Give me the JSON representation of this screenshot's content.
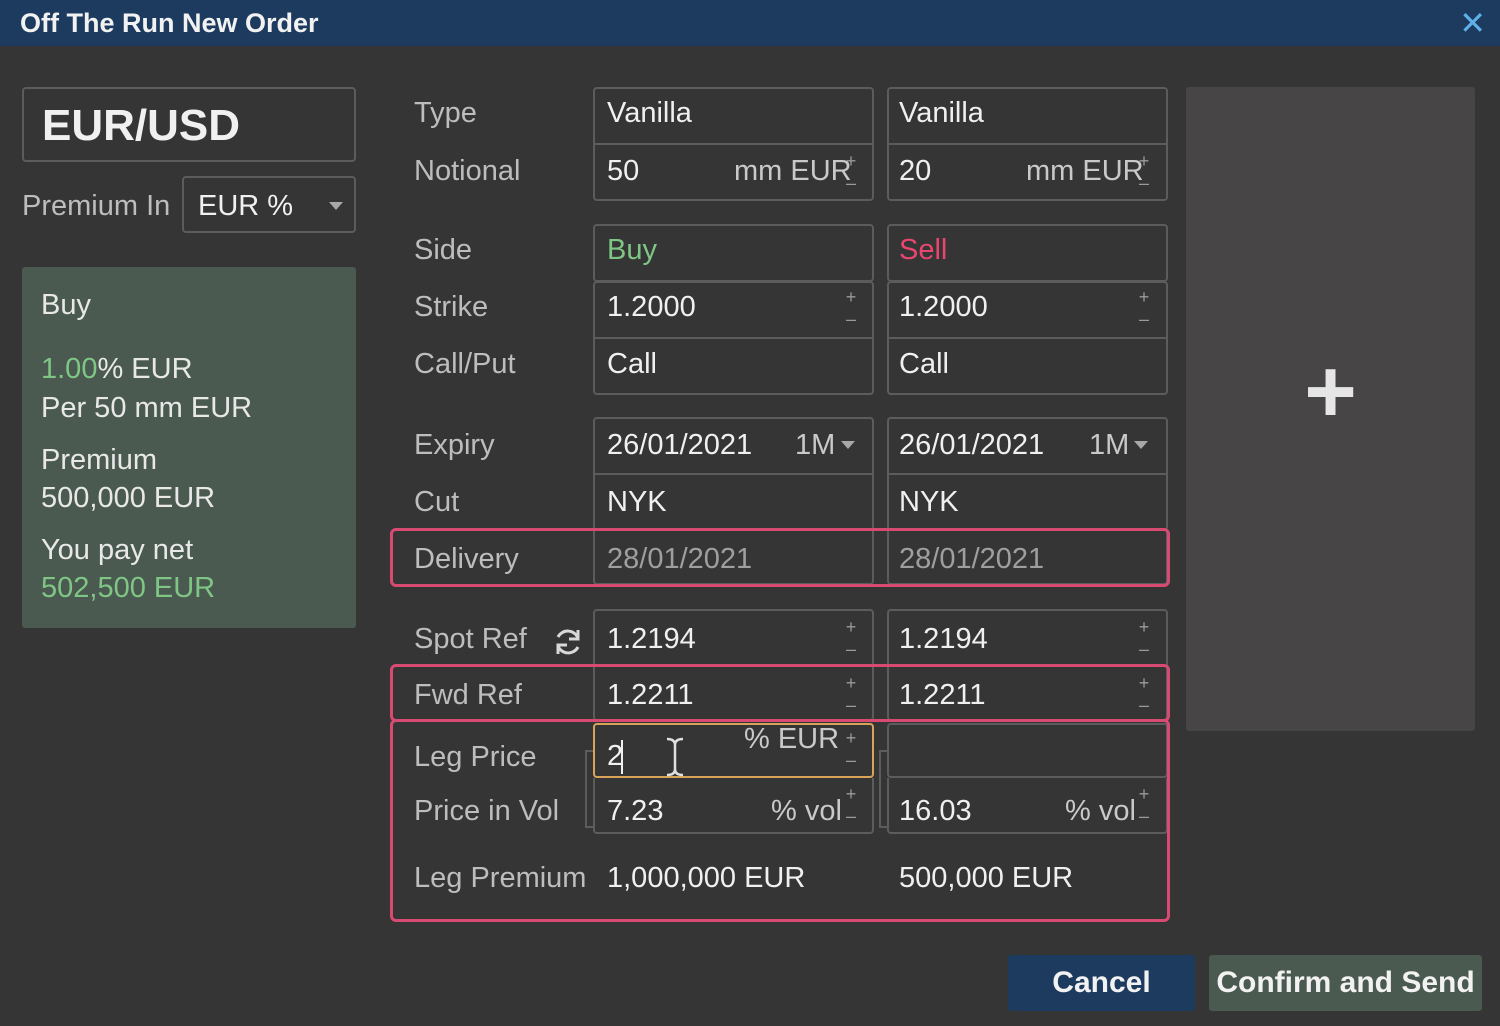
{
  "window": {
    "title": "Off The Run New Order",
    "close_glyph": "✕"
  },
  "pair": "EUR/USD",
  "premium_in": {
    "label": "Premium In",
    "value": "EUR %"
  },
  "summary": {
    "side": "Buy",
    "price_pct": "1.00",
    "price_unit": "% EUR",
    "per_line": "Per 50 mm EUR",
    "premium_label": "Premium",
    "premium_value": "500,000 EUR",
    "net_label": "You pay net",
    "net_value": "502,500 EUR"
  },
  "labels": {
    "type": "Type",
    "notional": "Notional",
    "side": "Side",
    "strike": "Strike",
    "callput": "Call/Put",
    "expiry": "Expiry",
    "cut": "Cut",
    "delivery": "Delivery",
    "spot_ref": "Spot Ref",
    "fwd_ref": "Fwd Ref",
    "leg_price": "Leg Price",
    "price_in_vol": "Price in Vol",
    "leg_premium": "Leg Premium"
  },
  "legs": [
    {
      "type": "Vanilla",
      "notional": "50",
      "notional_unit": "mm EUR",
      "side": "Buy",
      "strike": "1.2000",
      "callput": "Call",
      "expiry": "26/01/2021",
      "tenor": "1M",
      "cut": "NYK",
      "delivery": "28/01/2021",
      "spot_ref": "1.2194",
      "fwd_ref": "1.2211",
      "leg_price": "2",
      "leg_price_unit": "% EUR",
      "price_in_vol": "7.23",
      "vol_unit": "% vol",
      "leg_premium": "1,000,000 EUR"
    },
    {
      "type": "Vanilla",
      "notional": "20",
      "notional_unit": "mm EUR",
      "side": "Sell",
      "strike": "1.2000",
      "callput": "Call",
      "expiry": "26/01/2021",
      "tenor": "1M",
      "cut": "NYK",
      "delivery": "28/01/2021",
      "spot_ref": "1.2194",
      "fwd_ref": "1.2211",
      "leg_price": "",
      "leg_price_unit": "",
      "price_in_vol": "16.03",
      "vol_unit": "% vol",
      "leg_premium": "500,000 EUR"
    }
  ],
  "stepper": {
    "plus": "+",
    "minus": "–"
  },
  "add_leg_glyph": "+",
  "buttons": {
    "cancel": "Cancel",
    "confirm": "Confirm and Send"
  },
  "colors": {
    "title_bar": "#1c3b5f",
    "buy": "#7fc685",
    "sell": "#e8466f",
    "highlight": "#d94a72",
    "focus": "#d9a35a",
    "cancel_button": "#1c3b5f",
    "confirm_button": "#4a5a50"
  }
}
